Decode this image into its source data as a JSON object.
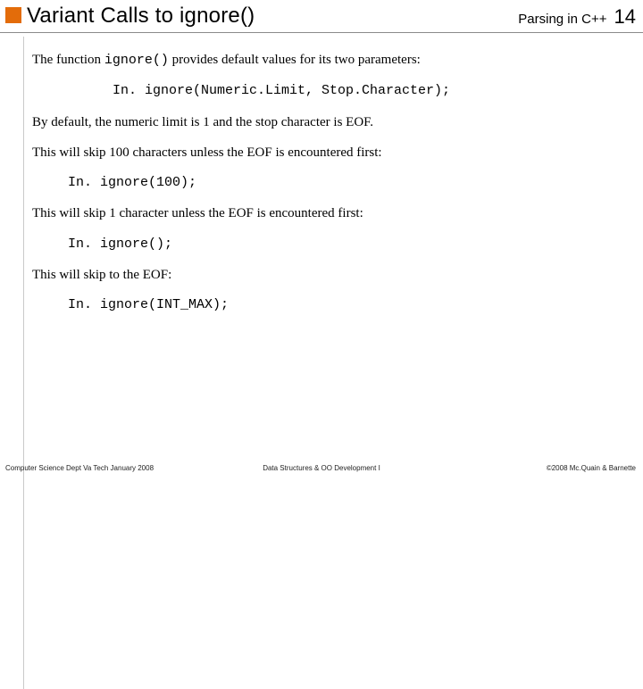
{
  "header": {
    "title": "Variant Calls to ignore()",
    "subject": "Parsing in C++",
    "slide_number": "14"
  },
  "body": {
    "intro_prefix": "The function ",
    "intro_code": "ignore()",
    "intro_suffix": " provides default values for its two parameters:",
    "signature": "In. ignore(Numeric.Limit, Stop.Character);",
    "default_note": "By default, the numeric limit is 1 and the stop character is EOF.",
    "case1_label": "This will skip 100 characters unless the EOF is encountered first:",
    "case1_code": "In. ignore(100);",
    "case2_label": "This will skip 1 character unless the EOF is encountered first:",
    "case2_code": "In. ignore();",
    "case3_label": "This will skip to the EOF:",
    "case3_code": "In. ignore(INT_MAX);"
  },
  "footer": {
    "left": "Computer Science Dept Va Tech January 2008",
    "center": "Data Structures & OO Development I",
    "right": "©2008  Mc.Quain & Barnette"
  }
}
